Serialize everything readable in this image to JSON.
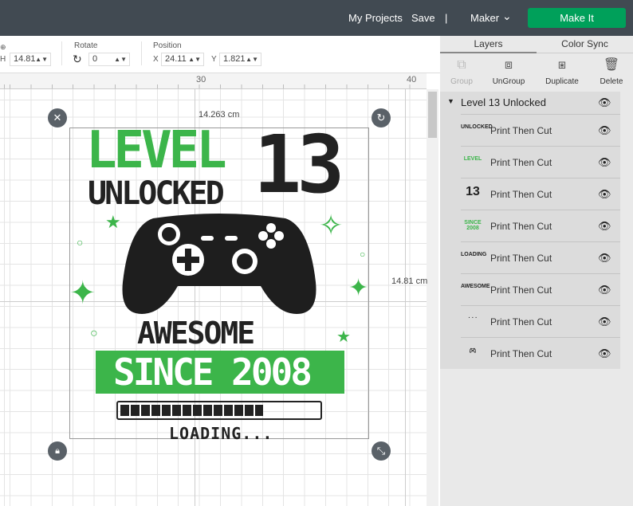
{
  "topbar": {
    "my_projects": "My Projects",
    "save": "Save",
    "divider": "|",
    "machine": "Maker",
    "make_it": "Make It"
  },
  "toolbar": {
    "h_label": "H",
    "h_value": "14.81",
    "rotate_label": "Rotate",
    "rotate_value": "0",
    "position_label": "Position",
    "x_label": "X",
    "x_value": "24.11",
    "y_label": "Y",
    "y_value": "1.821"
  },
  "ruler": {
    "ticks": [
      "30",
      "40"
    ]
  },
  "canvas": {
    "width_dim": "14.263 cm",
    "height_dim": "14.81 cm",
    "design": {
      "line1": "LEVEL",
      "number": "13",
      "line2": "UNLOCKED",
      "awesome": "AWESOME",
      "since": "SINCE 2008",
      "loading": "LOADING...",
      "progress": 0.72
    }
  },
  "panel": {
    "tabs": [
      "Layers",
      "Color Sync"
    ],
    "actions": [
      "Group",
      "UnGroup",
      "Duplicate",
      "Delete"
    ],
    "group_name": "Level 13 Unlocked",
    "layers": [
      {
        "thumb": "UNLOCKED",
        "name": "Print Then Cut"
      },
      {
        "thumb": "LEVEL",
        "name": "Print Then Cut"
      },
      {
        "thumb": "13",
        "name": "Print Then Cut"
      },
      {
        "thumb": "SINCE 2008",
        "name": "Print Then Cut"
      },
      {
        "thumb": "LOADING",
        "name": "Print Then Cut"
      },
      {
        "thumb": "AWESOME",
        "name": "Print Then Cut"
      },
      {
        "thumb": "· · ·",
        "name": "Print Then Cut"
      },
      {
        "thumb": "controller",
        "name": "Print Then Cut"
      }
    ]
  },
  "colors": {
    "accent": "#00a05a",
    "design_green": "#3cb54a",
    "topbar": "#414a52"
  }
}
